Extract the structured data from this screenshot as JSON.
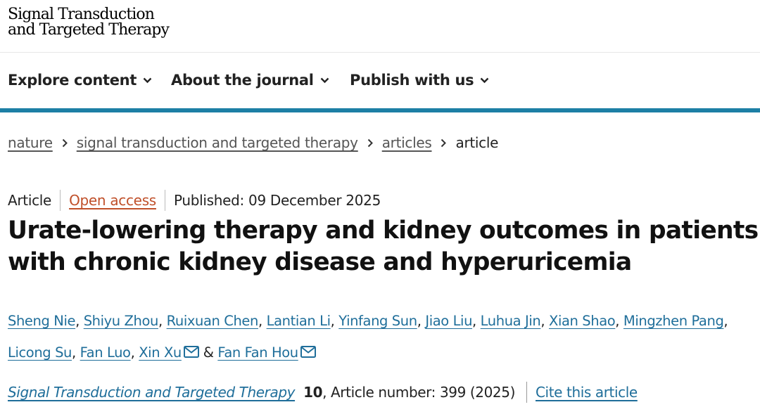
{
  "header": {
    "logo_line1": "Signal Transduction",
    "logo_line2": "and Targeted Therapy"
  },
  "nav": {
    "items": [
      {
        "label": "Explore content"
      },
      {
        "label": "About the journal"
      },
      {
        "label": "Publish with us"
      }
    ],
    "accent_color": "#1d7fa5"
  },
  "breadcrumb": {
    "items": [
      "nature",
      "signal transduction and targeted therapy",
      "articles"
    ],
    "current": "article"
  },
  "article": {
    "type": "Article",
    "access": "Open access",
    "published": "Published: 09 December 2025",
    "title": "Urate-lowering therapy and kidney outcomes in patients with chronic kidney disease and hyperuricemia",
    "authors": [
      "Sheng Nie",
      "Shiyu Zhou",
      "Ruixuan Chen",
      "Lantian Li",
      "Yinfang Sun",
      "Jiao Liu",
      "Luhua Jin",
      "Xian Shao",
      "Mingzhen Pang",
      "Licong Su",
      "Fan Luo",
      "Xin Xu",
      "Fan Fan Hou"
    ],
    "separator": ",",
    "ampersand": "&",
    "journal": "Signal Transduction and Targeted Therapy",
    "volume": "10",
    "article_number": ", Article number: 399 (2025)",
    "cite_label": "Cite this article"
  },
  "colors": {
    "link": "#1f6e9a",
    "open_access": "#c0502a"
  }
}
